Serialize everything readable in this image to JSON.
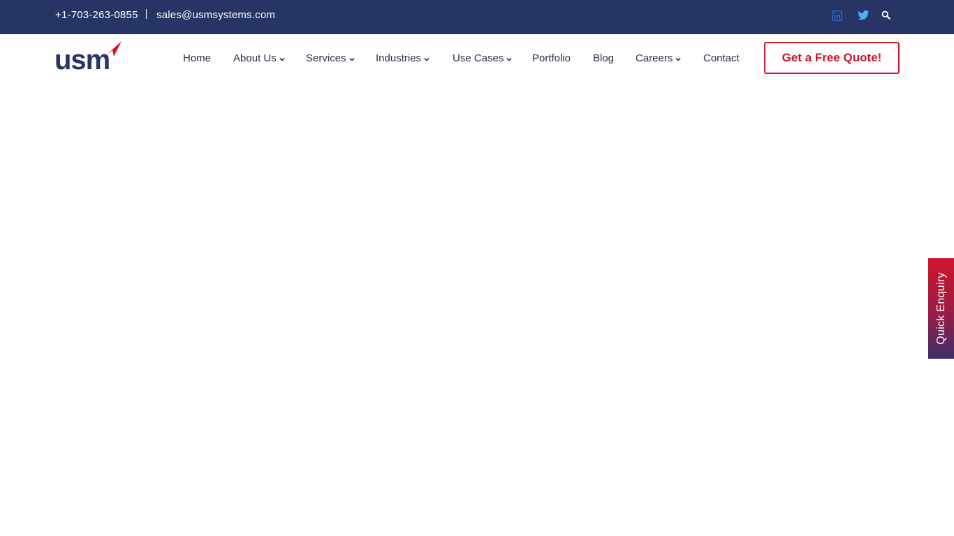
{
  "topbar": {
    "phone": "+1-703-263-0855",
    "email": "sales@usmsystems.com",
    "icons": [
      "linkedin-icon",
      "twitter-icon",
      "search-icon"
    ]
  },
  "logo": {
    "text": "usm"
  },
  "nav": {
    "items": [
      {
        "label": "Home",
        "dropdown": false
      },
      {
        "label": "About Us",
        "dropdown": true
      },
      {
        "label": "Services",
        "dropdown": true
      },
      {
        "label": "Industries",
        "dropdown": true
      },
      {
        "label": "Use Cases",
        "dropdown": true
      },
      {
        "label": "Portfolio",
        "dropdown": false
      },
      {
        "label": "Blog",
        "dropdown": false
      },
      {
        "label": "Careers",
        "dropdown": true
      },
      {
        "label": "Contact",
        "dropdown": false
      }
    ]
  },
  "cta": {
    "label": "Get a Free Quote!"
  },
  "quick_enquiry": {
    "label": "Quick Enquiry"
  },
  "colors": {
    "topbar_bg": "#263466",
    "brand_navy": "#263466",
    "brand_red": "#d0142c",
    "nav_text": "#2b2f4a",
    "linkedin": "#2f6fd0",
    "twitter": "#55acee"
  }
}
